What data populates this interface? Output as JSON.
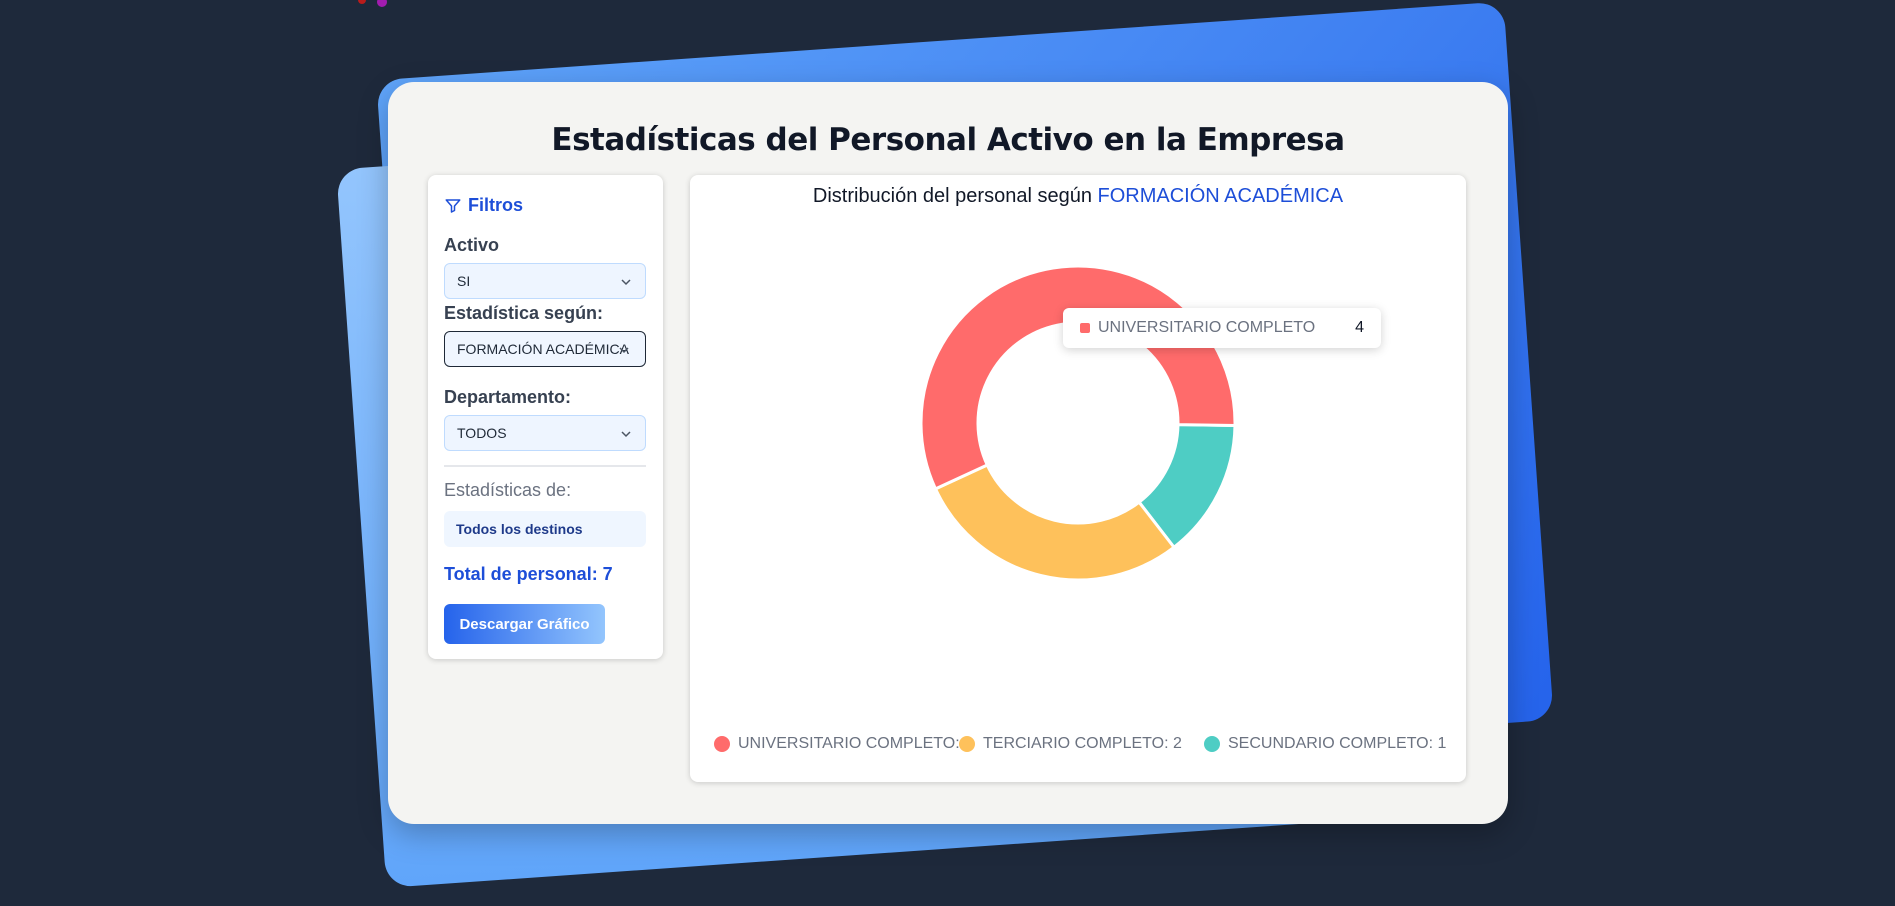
{
  "page": {
    "title": "Estadísticas del Personal Activo en la Empresa"
  },
  "filters": {
    "heading": "Filtros",
    "activo": {
      "label": "Activo",
      "value": "SI"
    },
    "estadistica": {
      "label": "Estadística según:",
      "value": "FORMACIÓN ACADÉMICA"
    },
    "departamento": {
      "label": "Departamento:",
      "value": "TODOS"
    },
    "stats_label": "Estadísticas de:",
    "stats_value": "Todos los destinos",
    "total": "Total de personal: 7",
    "download_label": "Descargar Gráfico"
  },
  "chart_panel": {
    "title_prefix": "Distribución del personal según",
    "title_accent": "FORMACIÓN ACADÉMICA",
    "tooltip": {
      "label": "UNIVERSITARIO COMPLETO",
      "value": "4",
      "color": "#ff6b6b"
    },
    "legend": [
      {
        "text": "UNIVERSITARIO COMPLETO: 4",
        "color": "#ff6b6b"
      },
      {
        "text": "TERCIARIO COMPLETO: 2",
        "color": "#fec15b"
      },
      {
        "text": "SECUNDARIO COMPLETO: 1",
        "color": "#4ecdc4"
      }
    ]
  },
  "chart_data": {
    "type": "pie",
    "donut": true,
    "categories": [
      "UNIVERSITARIO COMPLETO",
      "TERCIARIO COMPLETO",
      "SECUNDARIO COMPLETO"
    ],
    "values": [
      4,
      2,
      1
    ],
    "colors": [
      "#ff6b6b",
      "#fec15b",
      "#4ecdc4"
    ],
    "legend_position": "bottom"
  },
  "colors": {
    "accent": "#1d4ed8",
    "background": "#1e293b",
    "card": "#f4f4f2"
  }
}
